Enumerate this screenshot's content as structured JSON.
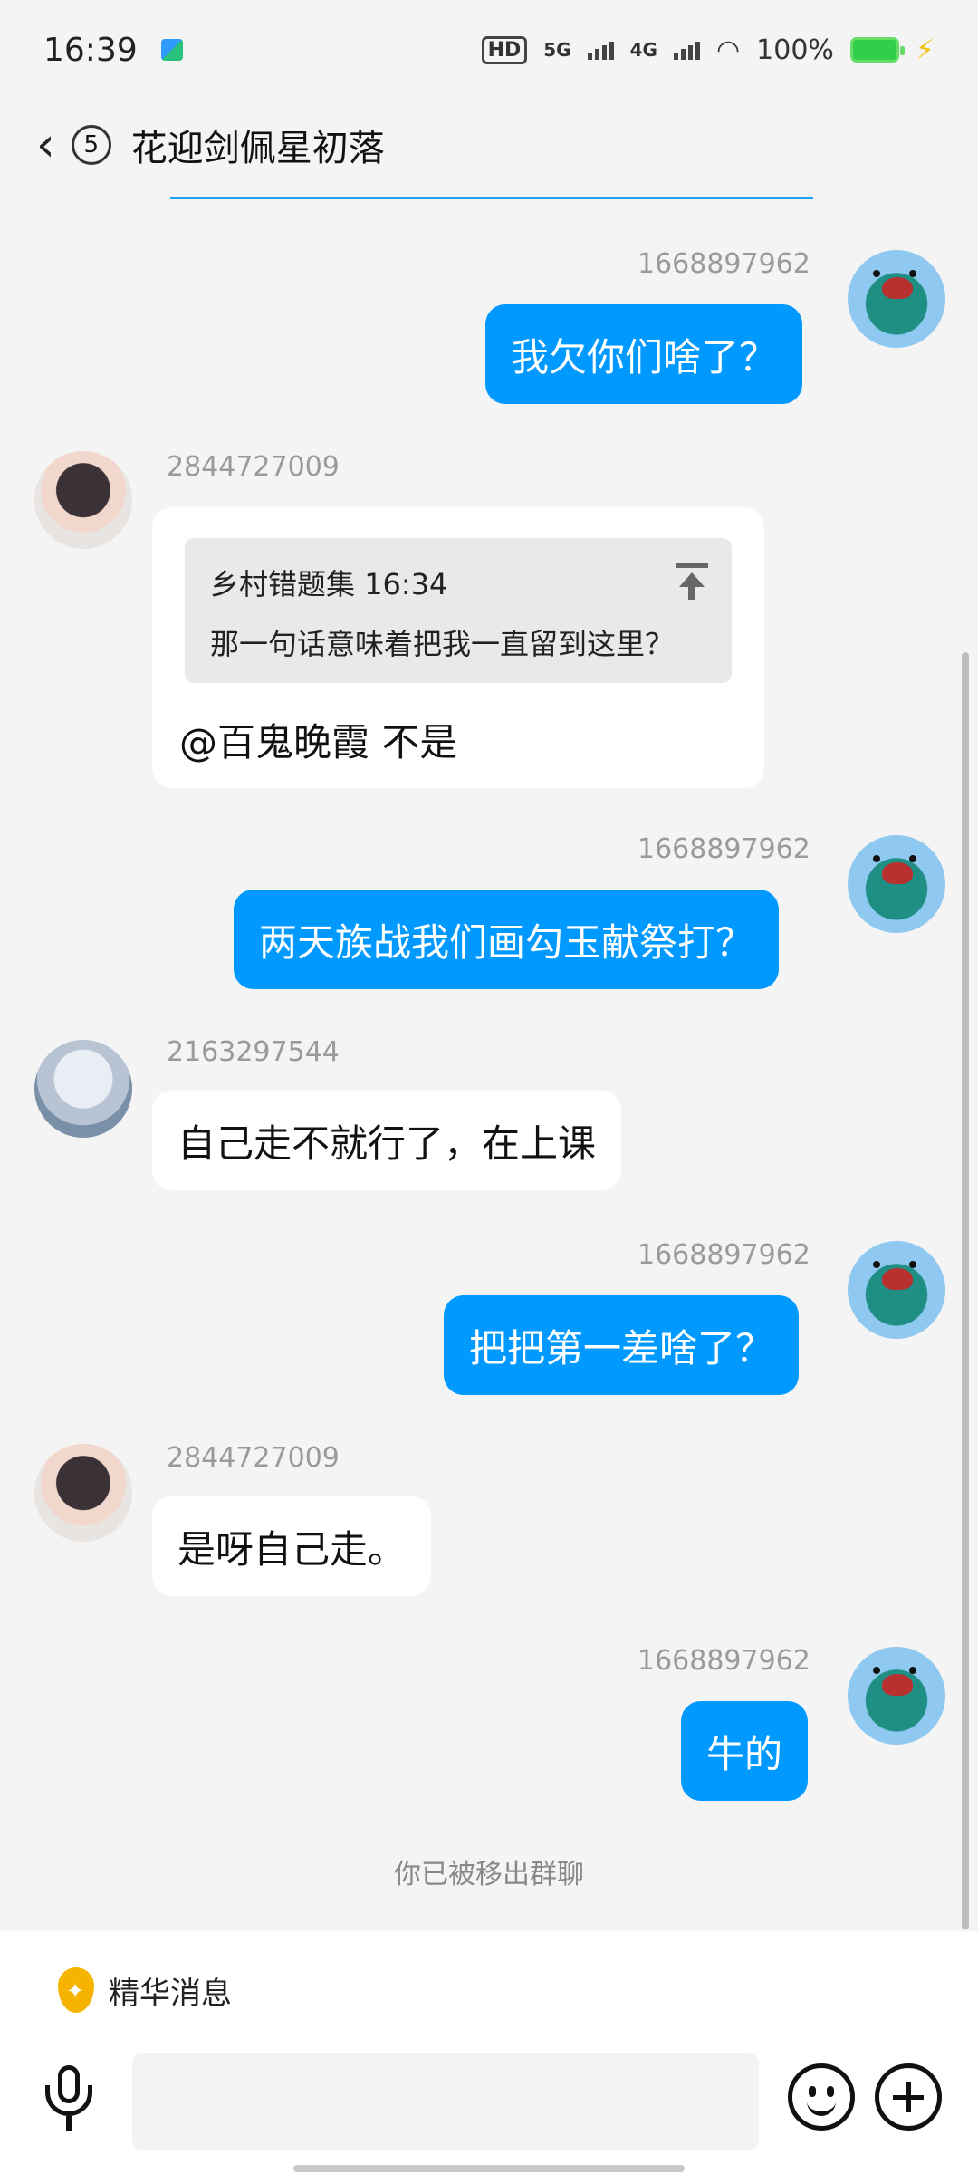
{
  "status_bar": {
    "time": "16:39",
    "hd_label": "HD",
    "net_5g": "5G",
    "net_4g": "4G",
    "battery_pct": "100%",
    "icons": [
      "app-notification-icon",
      "hd-icon",
      "signal-5g-icon",
      "signal-4g-icon",
      "wifi-icon",
      "battery-icon",
      "charging-bolt-icon"
    ]
  },
  "header": {
    "back_icon": "chevron-left-icon",
    "unread_count": "5",
    "title": "花迎剑佩星初落"
  },
  "messages": [
    {
      "sender": "1668897962",
      "text": "我欠你们啥了？",
      "direction": "out"
    },
    {
      "sender": "2844727009",
      "direction": "in",
      "quote": {
        "author": "乡村错题集",
        "time": "16:34",
        "text": "那一句话意味着把我一直留到这里？"
      },
      "text": "@百鬼晚霞 不是"
    },
    {
      "sender": "1668897962",
      "text": "两天族战我们画勾玉献祭打？",
      "direction": "out"
    },
    {
      "sender": "2163297544",
      "text": "自己走不就行了，在上课",
      "direction": "in"
    },
    {
      "sender": "1668897962",
      "text": "把把第一差啥了？",
      "direction": "out"
    },
    {
      "sender": "2844727009",
      "text": "是呀自己走。",
      "direction": "in"
    },
    {
      "sender": "1668897962",
      "text": "牛的",
      "direction": "out"
    }
  ],
  "system_note": "你已被移出群聊",
  "bottom": {
    "essence_label": "精华消息",
    "input_placeholder": "",
    "icons": [
      "essence-drop-icon",
      "microphone-icon",
      "emoji-icon",
      "plus-icon"
    ]
  },
  "colors": {
    "outgoing_bubble": "#0099ff",
    "incoming_bubble": "#ffffff",
    "background": "#f4f4f4",
    "accent_line": "#1aa4f3"
  }
}
